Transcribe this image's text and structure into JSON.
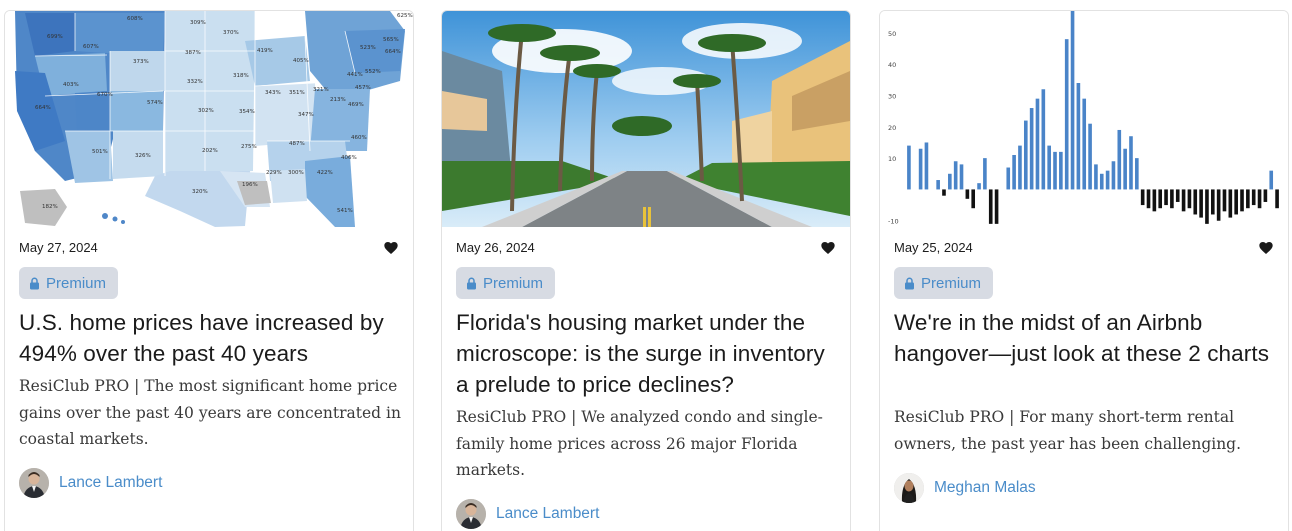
{
  "cards": [
    {
      "date": "May 27, 2024",
      "badge": "Premium",
      "title": "U.S. home prices have increased by 494% over the past 40 years",
      "description": "ResiClub PRO | The most significant home price gains over the past 40 years are concentrated in coastal markets.",
      "author": "Lance Lambert",
      "image": {
        "type": "us-map",
        "state_labels": [
          "608%",
          "309%",
          "370%",
          "699%",
          "607%",
          "373%",
          "387%",
          "419%",
          "405%",
          "523%",
          "565%",
          "664%",
          "403%",
          "670%",
          "574%",
          "332%",
          "318%",
          "343%",
          "351%",
          "321%",
          "441%",
          "552%",
          "457%",
          "213%",
          "469%",
          "664%",
          "302%",
          "354%",
          "347%",
          "501%",
          "326%",
          "202%",
          "275%",
          "487%",
          "460%",
          "406%",
          "229%",
          "300%",
          "422%",
          "196%",
          "320%",
          "182%",
          "541%",
          "625%"
        ]
      }
    },
    {
      "date": "May 26, 2024",
      "badge": "Premium",
      "title": "Florida's housing market under the microscope: is the surge in inventory a prelude to price declines?",
      "description": "ResiClub PRO | We analyzed condo and single-family home prices across 26 major Florida markets.",
      "author": "Lance Lambert",
      "image": {
        "type": "photo-palm-street"
      }
    },
    {
      "date": "May 25, 2024",
      "badge": "Premium",
      "title": "We're in the midst of an Airbnb hangover—just look at these 2 charts",
      "description": "ResiClub PRO | For many short-term rental owners, the past year has been challenging.",
      "author": "Meghan Malas",
      "image": {
        "type": "bar-chart"
      }
    }
  ],
  "chart_data": {
    "type": "bar",
    "y_tick_labels": [
      "50",
      "40",
      "30",
      "20",
      "10",
      "-10"
    ],
    "ylim": [
      -12,
      57
    ],
    "values": [
      14,
      0,
      13,
      15,
      0,
      3,
      -2,
      5,
      9,
      8,
      -3,
      -6,
      2,
      10,
      -11,
      -11,
      0,
      7,
      11,
      14,
      22,
      26,
      29,
      32,
      14,
      12,
      12,
      48,
      57,
      34,
      29,
      21,
      8,
      5,
      6,
      9,
      19,
      13,
      17,
      10,
      -5,
      -6,
      -7,
      -6,
      -5,
      -6,
      -4,
      -7,
      -6,
      -8,
      -9,
      -11,
      -8,
      -10,
      -7,
      -9,
      -8,
      -7,
      -6,
      -5,
      -6,
      -4,
      6,
      -6
    ],
    "series_colors": {
      "positive": "#4a84c8",
      "negative": "#111111"
    },
    "grid": false
  },
  "colors": {
    "accent": "#4a8cc9",
    "badge_bg": "#d7dbe3",
    "heart": "#1a1a1a"
  },
  "icons": {
    "heart": "heart-icon",
    "lock": "lock-icon"
  }
}
